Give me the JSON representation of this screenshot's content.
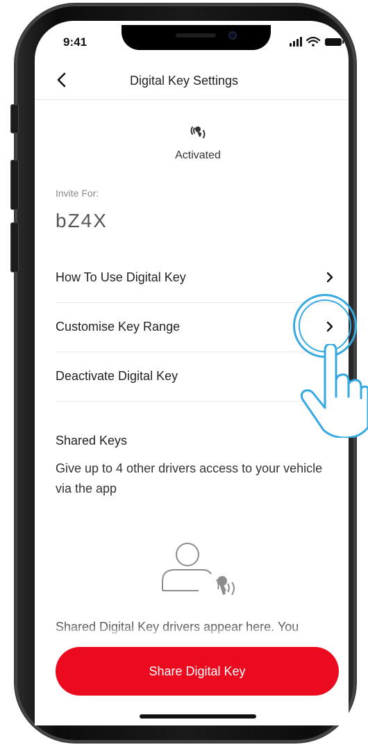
{
  "status_bar": {
    "time": "9:41",
    "icons": [
      "signal-icon",
      "wifi-icon",
      "battery-icon"
    ]
  },
  "nav": {
    "title": "Digital Key Settings",
    "back_icon": "chevron-left-icon"
  },
  "key_status": {
    "icon": "digital-key-icon",
    "text": "Activated"
  },
  "invite": {
    "label": "Invite For:",
    "vehicle": "bZ4X"
  },
  "menu": [
    {
      "label": "How To Use Digital Key"
    },
    {
      "label": "Customise Key Range"
    },
    {
      "label": "Deactivate Digital Key"
    }
  ],
  "shared_keys": {
    "title": "Shared Keys",
    "description": "Give up to 4 other drivers access to your vehicle via the app",
    "empty_text": "Shared Digital Key drivers appear here. You"
  },
  "share_button": {
    "label": "Share Digital Key"
  },
  "colors": {
    "accent": "#eb0a1e",
    "tap_highlight": "#36a9e1"
  }
}
